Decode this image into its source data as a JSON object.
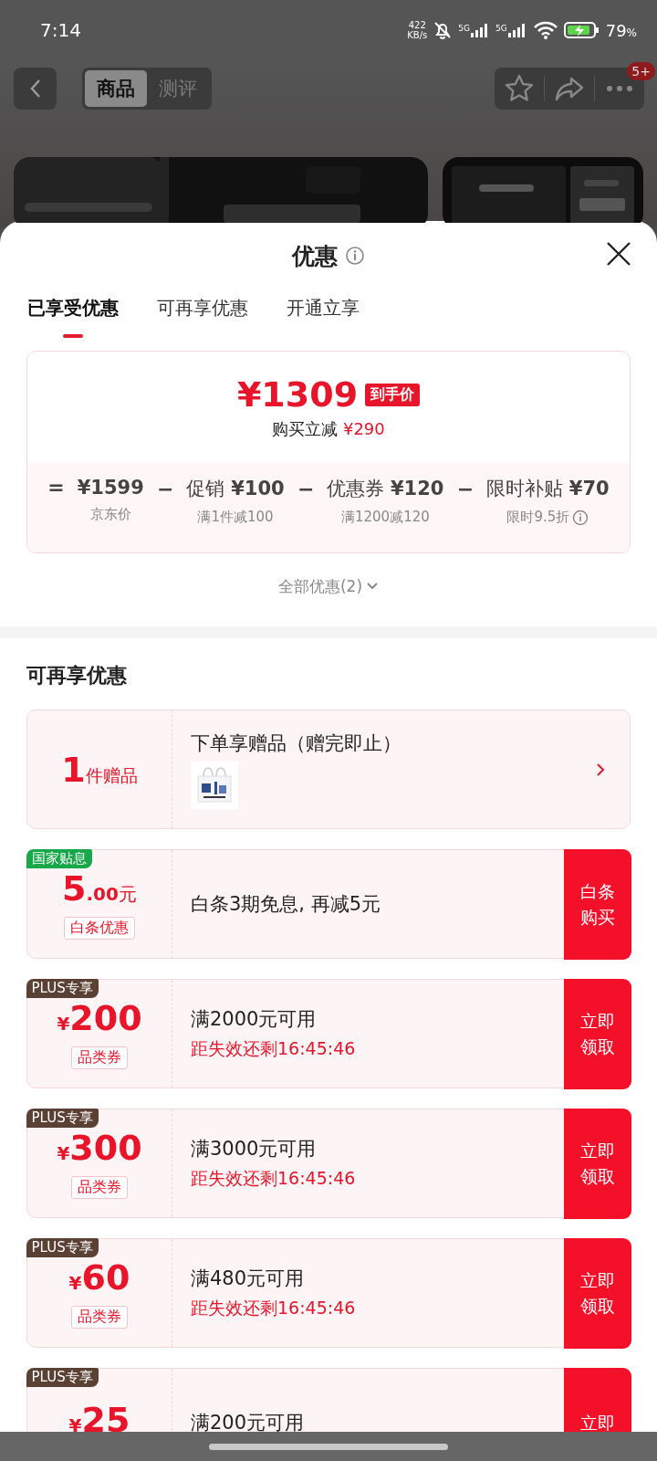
{
  "status_bar": {
    "time": "7:14",
    "net_speed": "422",
    "net_unit": "KB/s",
    "networks": [
      "5G",
      "5G"
    ],
    "battery": "79",
    "battery_unit": "%"
  },
  "header": {
    "tabs": [
      {
        "label": "商品",
        "selected": true
      },
      {
        "label": "测评",
        "selected": false
      }
    ],
    "badge": "5+"
  },
  "sheet": {
    "title": "优惠",
    "tabs": [
      {
        "label": "已享受优惠",
        "selected": true
      },
      {
        "label": "可再享优惠",
        "selected": false
      },
      {
        "label": "开通立享",
        "selected": false
      }
    ],
    "price": {
      "amount": "¥1309",
      "tag": "到手价",
      "saving_label": "购买立减",
      "saving": "¥290",
      "terms": [
        {
          "op": "=",
          "value": "¥1599",
          "note": "京东价",
          "info": false
        },
        {
          "op": "−",
          "label": "促销",
          "value": "¥100",
          "note": "满1件减100",
          "info": false
        },
        {
          "op": "−",
          "label": "优惠券",
          "value": "¥120",
          "note": "满1200减120",
          "info": false
        },
        {
          "op": "−",
          "label": "限时补贴",
          "value": "¥70",
          "note": "限时9.5折",
          "info": true
        }
      ]
    },
    "more": "全部优惠(2)"
  },
  "section_title": "可再享优惠",
  "offers": [
    {
      "kind": "gift",
      "count": "1",
      "unit": "件赠品",
      "title": "下单享赠品（赠完即止）"
    },
    {
      "kind": "credit",
      "badge": "国家贴息",
      "color": "#17a84a",
      "amount": "5",
      "decimals": ".00",
      "unit": "元",
      "tag": "白条优惠",
      "title": "白条3期免息, 再减5元",
      "button": "白条购买"
    },
    {
      "kind": "coupon",
      "badge": "PLUS专享",
      "color": "#5b4034",
      "currency": "¥",
      "amount": "200",
      "tag": "品类券",
      "title": "满2000元可用",
      "countdown": "距失效还剩16:45:46",
      "button": "立即领取"
    },
    {
      "kind": "coupon",
      "badge": "PLUS专享",
      "color": "#5b4034",
      "currency": "¥",
      "amount": "300",
      "tag": "品类券",
      "title": "满3000元可用",
      "countdown": "距失效还剩16:45:46",
      "button": "立即领取"
    },
    {
      "kind": "coupon",
      "badge": "PLUS专享",
      "color": "#5b4034",
      "currency": "¥",
      "amount": "60",
      "tag": "品类券",
      "title": "满480元可用",
      "countdown": "距失效还剩16:45:46",
      "button": "立即领取"
    },
    {
      "kind": "coupon",
      "badge": "PLUS专享",
      "color": "#5b4034",
      "currency": "¥",
      "amount": "25",
      "title": "满200元可用",
      "button": "立即"
    }
  ]
}
